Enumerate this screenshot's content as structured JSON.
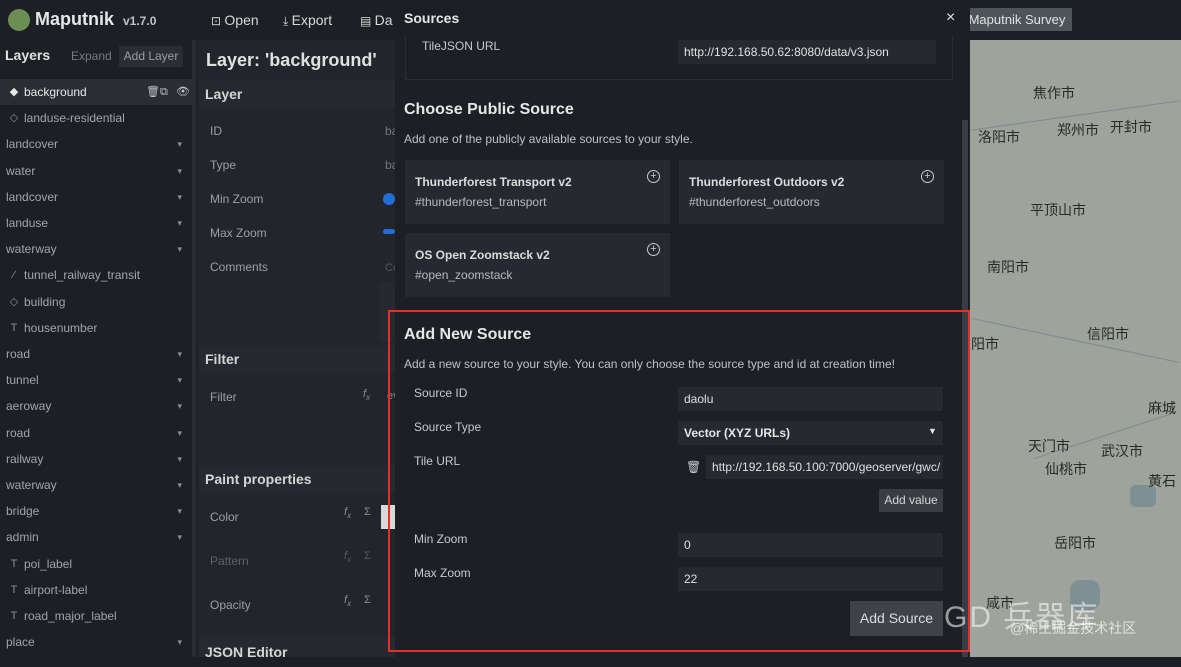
{
  "app": {
    "name": "Maputnik",
    "version": "v1.7.0"
  },
  "toolbar": {
    "open": "Open",
    "export": "Export",
    "data": "Da",
    "survey": "Maputnik Survey"
  },
  "layers": {
    "title": "Layers",
    "expand": "Expand",
    "add_layer": "Add Layer",
    "items": [
      {
        "label": "background",
        "icon": "diamond-icon",
        "group": false,
        "selected": true
      },
      {
        "label": "landuse-residential",
        "icon": "diamond-outline-icon",
        "group": false
      },
      {
        "label": "landcover",
        "group": true
      },
      {
        "label": "water",
        "group": true
      },
      {
        "label": "landcover",
        "group": true
      },
      {
        "label": "landuse",
        "group": true
      },
      {
        "label": "waterway",
        "group": true
      },
      {
        "label": "tunnel_railway_transit",
        "icon": "line-icon",
        "group": false
      },
      {
        "label": "building",
        "icon": "diamond-outline-icon",
        "group": false
      },
      {
        "label": "housenumber",
        "icon": "text-icon",
        "group": false
      },
      {
        "label": "road",
        "group": true
      },
      {
        "label": "tunnel",
        "group": true
      },
      {
        "label": "aeroway",
        "group": true
      },
      {
        "label": "road",
        "group": true
      },
      {
        "label": "railway",
        "group": true
      },
      {
        "label": "waterway",
        "group": true
      },
      {
        "label": "bridge",
        "group": true
      },
      {
        "label": "admin",
        "group": true
      },
      {
        "label": "poi_label",
        "icon": "text-icon",
        "group": false
      },
      {
        "label": "airport-label",
        "icon": "text-icon",
        "group": false
      },
      {
        "label": "road_major_label",
        "icon": "text-icon",
        "group": false
      },
      {
        "label": "place",
        "group": true
      }
    ]
  },
  "editor": {
    "title": "Layer: 'background'",
    "layer_section": "Layer",
    "id_label": "ID",
    "id_value": "ba",
    "type_label": "Type",
    "type_value": "ba",
    "minzoom_label": "Min Zoom",
    "maxzoom_label": "Max Zoom",
    "comments_label": "Comments",
    "comments_value": "Co",
    "filter_section": "Filter",
    "filter_label": "Filter",
    "filter_value": "ev",
    "paint_section": "Paint properties",
    "color_label": "Color",
    "pattern_label": "Pattern",
    "opacity_label": "Opacity",
    "json_section": "JSON Editor",
    "fx": "f",
    "fx_sub": "x",
    "sigma": "Σ"
  },
  "modal": {
    "title": "Sources",
    "close": "×",
    "tilejson_label": "TileJSON URL",
    "tilejson_value": "http://192.168.50.62:8080/data/v3.json",
    "public_title": "Choose Public Source",
    "public_desc": "Add one of the publicly available sources to your style.",
    "public_sources": [
      {
        "title": "Thunderforest Transport v2",
        "id": "#thunderforest_transport"
      },
      {
        "title": "Thunderforest Outdoors v2",
        "id": "#thunderforest_outdoors"
      },
      {
        "title": "OS Open Zoomstack v2",
        "id": "#open_zoomstack"
      }
    ],
    "new_title": "Add New Source",
    "new_desc": "Add a new source to your style. You can only choose the source type and id at creation time!",
    "source_id_label": "Source ID",
    "source_id_value": "daolu",
    "source_type_label": "Source Type",
    "source_type_value": "Vector (XYZ URLs)",
    "tile_url_label": "Tile URL",
    "tile_url_value": "http://192.168.50.100:7000/geoserver/gwc/",
    "add_value": "Add value",
    "min_zoom_label": "Min Zoom",
    "min_zoom_value": "0",
    "max_zoom_label": "Max Zoom",
    "max_zoom_value": "22",
    "add_source": "Add Source"
  },
  "map": {
    "cities": [
      "焦作市",
      "洛阳市",
      "郑州市",
      "开封市",
      "平顶山市",
      "南阳市",
      "信阳市",
      "阳市",
      "麻城",
      "天门市",
      "武汉市",
      "仙桃市",
      "黄石",
      "岳阳市",
      "咸市"
    ]
  },
  "watermark": {
    "logo": "GD 兵器库",
    "text": "@稀土掘金技术社区"
  },
  "colors": {
    "highlight": "#e0302a",
    "slider": "#1f6fd6",
    "map": "#9ea39c"
  }
}
